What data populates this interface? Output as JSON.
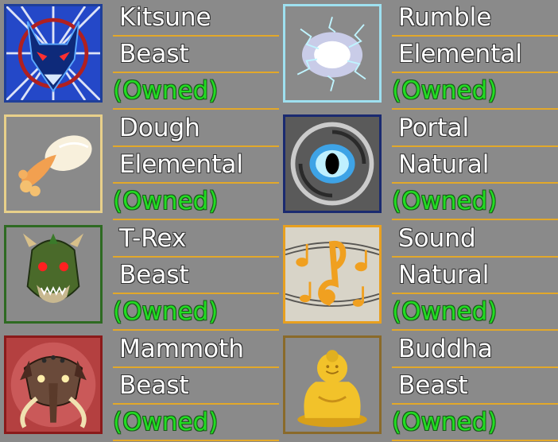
{
  "fruits": [
    {
      "name": "Kitsune",
      "type": "Beast",
      "status": "(Owned)",
      "icon": "kitsune-icon",
      "border": "#1f3f99",
      "bg": "#2448c8"
    },
    {
      "name": "Dough",
      "type": "Elemental",
      "status": "(Owned)",
      "icon": "dough-icon",
      "border": "#e8d08a",
      "bg": "#8a8a8a"
    },
    {
      "name": "T-Rex",
      "type": "Beast",
      "status": "(Owned)",
      "icon": "trex-icon",
      "border": "#2e6a22",
      "bg": "#8a8a8a"
    },
    {
      "name": "Mammoth",
      "type": "Beast",
      "status": "(Owned)",
      "icon": "mammoth-icon",
      "border": "#8a1a1a",
      "bg": "#9a3a3a"
    },
    {
      "name": "Rumble",
      "type": "Elemental",
      "status": "(Owned)",
      "icon": "rumble-icon",
      "border": "#9ee0f0",
      "bg": "#8a8a8a"
    },
    {
      "name": "Portal",
      "type": "Natural",
      "status": "(Owned)",
      "icon": "portal-icon",
      "border": "#1a2a70",
      "bg": "#6a6a6a"
    },
    {
      "name": "Sound",
      "type": "Natural",
      "status": "(Owned)",
      "icon": "sound-icon",
      "border": "#e8a020",
      "bg": "#8a8a8a"
    },
    {
      "name": "Buddha",
      "type": "Beast",
      "status": "(Owned)",
      "icon": "buddha-icon",
      "border": "#8a6a2a",
      "bg": "#8a8a8a"
    }
  ],
  "colors": {
    "accent_line": "#e2a82a",
    "owned": "#22dd22"
  }
}
